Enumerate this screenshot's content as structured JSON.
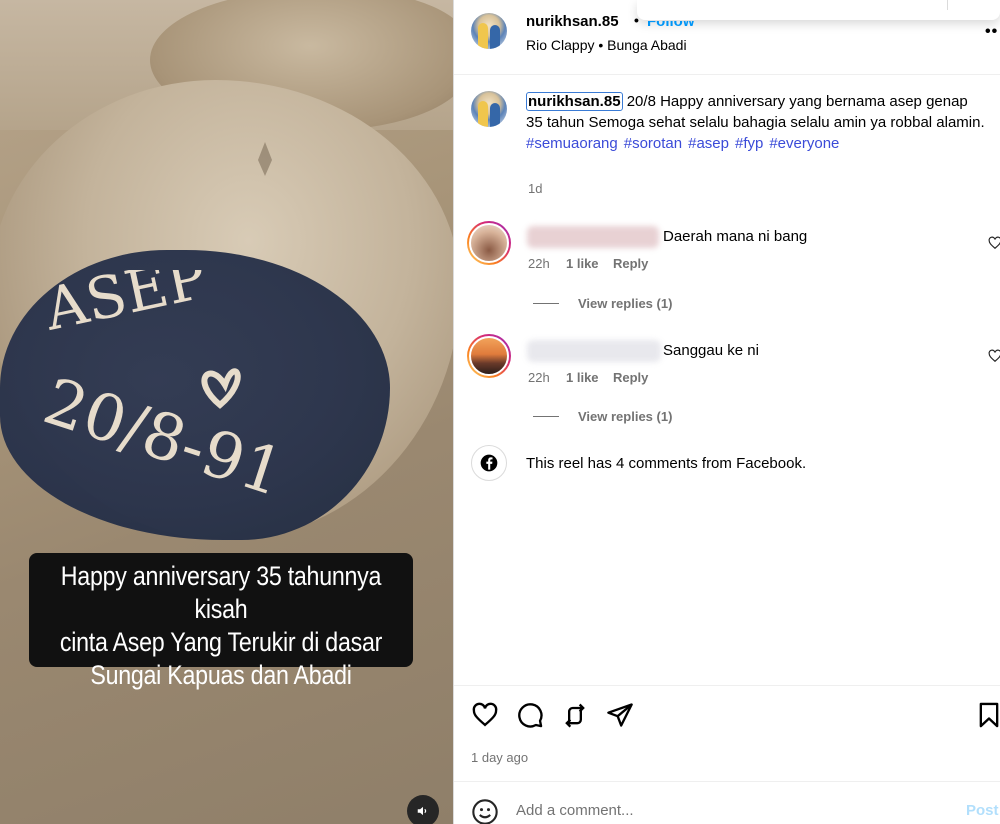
{
  "video": {
    "overlay_caption": [
      "Happy anniversary 35 tahunnya kisah",
      "cinta Asep Yang Terukir di dasar",
      "Sungai Kapuas dan Abadi"
    ],
    "carving": {
      "line1": "ASEP",
      "line2": "20/8-91"
    }
  },
  "header": {
    "username": "nurikhsan.85",
    "separator": "•",
    "follow_label": "Follow",
    "audio": "Rio Clappy • Bunga Abadi",
    "more_icon": "more-horizontal-icon"
  },
  "caption": {
    "username": "nurikhsan.85",
    "text": " 20/8 Happy anniversary yang bernama asep genap 35 tahun Semoga sehat selalu bahagia selalu amin ya robbal alamin.",
    "hashtags": [
      "#semuaorang",
      "#sorotan",
      "#asep",
      "#fyp",
      "#everyone"
    ],
    "time": "1d"
  },
  "comments": [
    {
      "text": "Daerah mana ni bang",
      "time": "22h",
      "likes": "1 like",
      "reply_label": "Reply",
      "view_replies": "View replies (1)"
    },
    {
      "text": "Sanggau ke ni",
      "time": "22h",
      "likes": "1 like",
      "reply_label": "Reply",
      "view_replies": "View replies (1)"
    }
  ],
  "facebook_note": "This reel has 4 comments from Facebook.",
  "actions": {
    "time_ago": "1 day ago",
    "icons": [
      "heart-icon",
      "comment-icon",
      "repost-icon",
      "share-icon",
      "bookmark-icon"
    ]
  },
  "composer": {
    "placeholder": "Add a comment...",
    "post_label": "Post"
  },
  "colors": {
    "link_blue": "#0095f6",
    "hashtag": "#3b4bd8",
    "muted": "#737373"
  }
}
